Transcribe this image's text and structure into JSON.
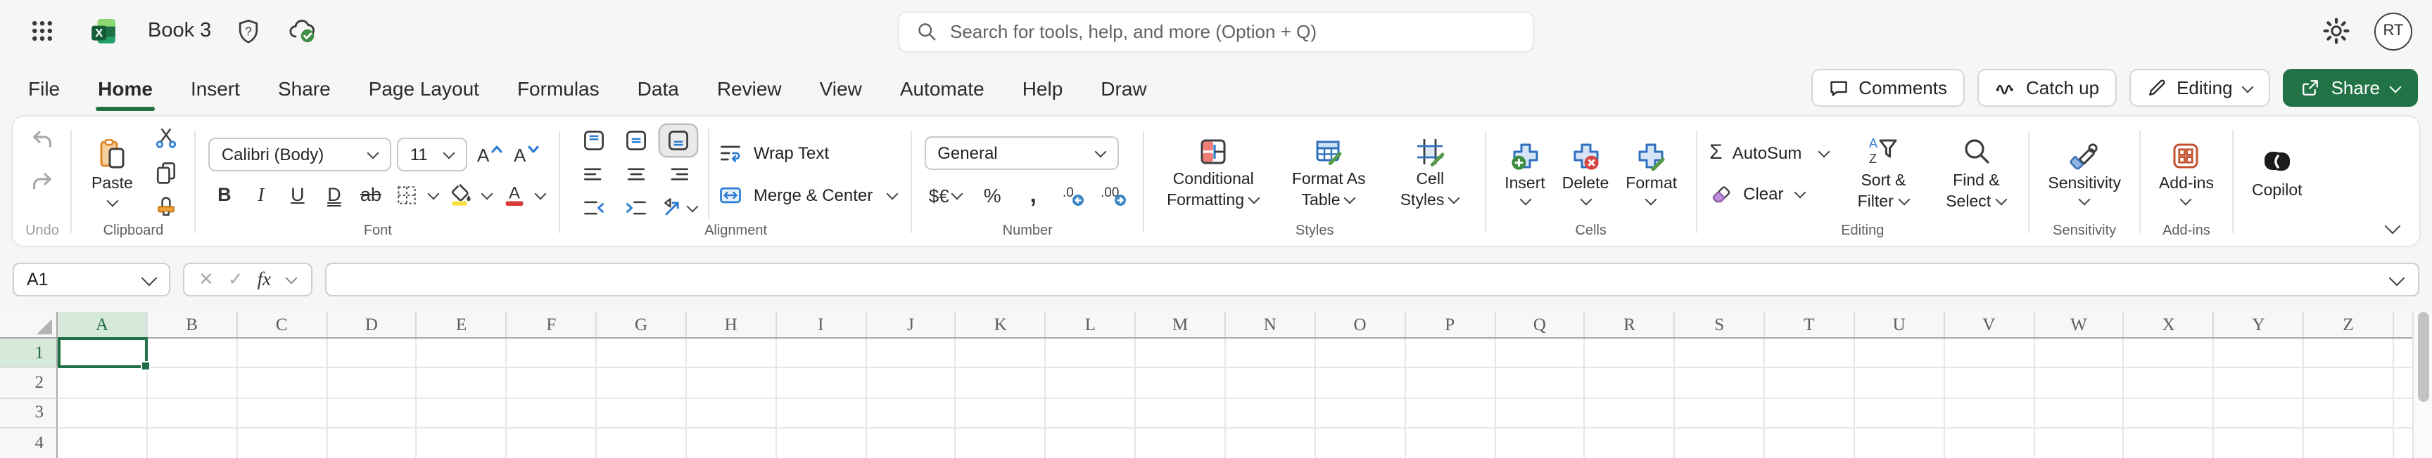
{
  "colors": {
    "excel_green": "#217346",
    "selection_green": "#1f7045",
    "accent_blue": "#2b7cd3"
  },
  "topbar": {
    "doc_title": "Book 3",
    "search_placeholder": "Search for tools, help, and more (Option + Q)",
    "avatar_initials": "RT"
  },
  "menubar": {
    "tabs": [
      {
        "label": "File"
      },
      {
        "label": "Home",
        "active": true
      },
      {
        "label": "Insert"
      },
      {
        "label": "Share"
      },
      {
        "label": "Page Layout"
      },
      {
        "label": "Formulas"
      },
      {
        "label": "Data"
      },
      {
        "label": "Review"
      },
      {
        "label": "View"
      },
      {
        "label": "Automate"
      },
      {
        "label": "Help"
      },
      {
        "label": "Draw"
      }
    ],
    "comments_label": "Comments",
    "catchup_label": "Catch up",
    "editing_label": "Editing",
    "share_label": "Share"
  },
  "ribbon": {
    "undo_group_label": "Undo",
    "clipboard": {
      "paste_label": "Paste",
      "group_label": "Clipboard"
    },
    "font": {
      "font_name": "Calibri (Body)",
      "font_size": "11",
      "bold": "B",
      "italic": "I",
      "underline": "U",
      "double_underline": "D",
      "strikethrough": "ab",
      "group_label": "Font"
    },
    "alignment": {
      "wrap_text_label": "Wrap Text",
      "merge_center_label": "Merge & Center",
      "group_label": "Alignment"
    },
    "number": {
      "format": "General",
      "currency_label": "$€",
      "percent_label": "%",
      "comma_label": ",",
      "decrease_decimal_glyph": ".0",
      "increase_decimal_glyph": ".00",
      "group_label": "Number"
    },
    "styles": {
      "conditional_label": "Conditional Formatting",
      "table_label": "Format As Table",
      "cellstyles_label": "Cell Styles",
      "group_label": "Styles"
    },
    "cells": {
      "insert_label": "Insert",
      "delete_label": "Delete",
      "format_label": "Format",
      "group_label": "Cells"
    },
    "editing": {
      "sigma": "Σ",
      "autosum_label": "AutoSum",
      "clear_label": "Clear",
      "sort_label": "Sort & Filter",
      "find_label": "Find & Select",
      "sort_a": "A",
      "sort_z": "Z",
      "group_label": "Editing"
    },
    "sensitivity": {
      "button_label": "Sensitivity",
      "group_label": "Sensitivity"
    },
    "addins": {
      "button_label": "Add-ins",
      "group_label": "Add-ins"
    },
    "copilot_label": "Copilot"
  },
  "formula_bar": {
    "name_box": "A1",
    "cancel_glyph": "✕",
    "enter_glyph": "✓",
    "fx_label": "fx",
    "formula_value": ""
  },
  "grid": {
    "columns": [
      "A",
      "B",
      "C",
      "D",
      "E",
      "F",
      "G",
      "H",
      "I",
      "J",
      "K",
      "L",
      "M",
      "N",
      "O",
      "P",
      "Q",
      "R",
      "S",
      "T",
      "U",
      "V",
      "W",
      "X",
      "Y",
      "Z"
    ],
    "visible_rows": [
      "1",
      "2",
      "3",
      "4"
    ],
    "selected_cell": "A1",
    "selected_column": "A",
    "selected_row": "1"
  },
  "icon_glyphs": {
    "help_q": "?",
    "excel_x": "X"
  }
}
